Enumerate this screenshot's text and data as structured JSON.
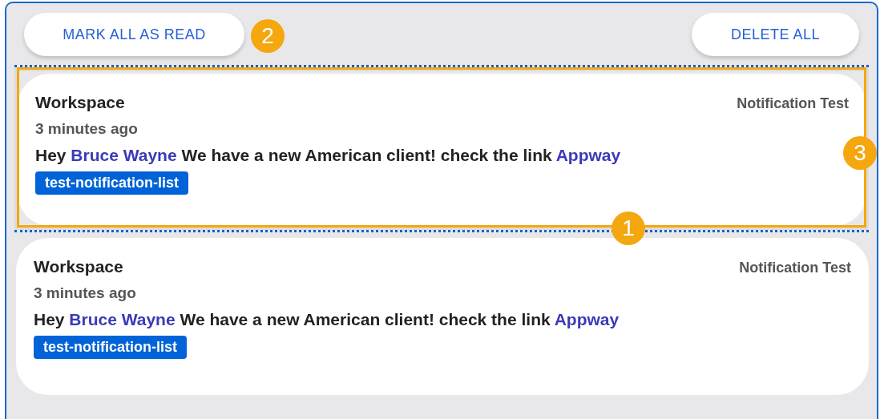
{
  "toolbar": {
    "mark_all_button": "MARK ALL AS READ",
    "delete_all_button": "DELETE ALL"
  },
  "notifications": [
    {
      "title": "Workspace",
      "time": "3 minutes ago",
      "source": "Notification Test",
      "greeting": "Hey",
      "user_link": "Bruce Wayne",
      "message": "We have a new American client! check the link",
      "app_link": "Appway",
      "tag": "test-notification-list",
      "highlighted": true
    },
    {
      "title": "Workspace",
      "time": "3 minutes ago",
      "source": "Notification Test",
      "greeting": "Hey",
      "user_link": "Bruce Wayne",
      "message": "We have a new American client! check the link",
      "app_link": "Appway",
      "tag": "test-notification-list",
      "highlighted": false
    }
  ],
  "callouts": [
    {
      "label": "2"
    },
    {
      "label": "3"
    },
    {
      "label": "1"
    }
  ]
}
